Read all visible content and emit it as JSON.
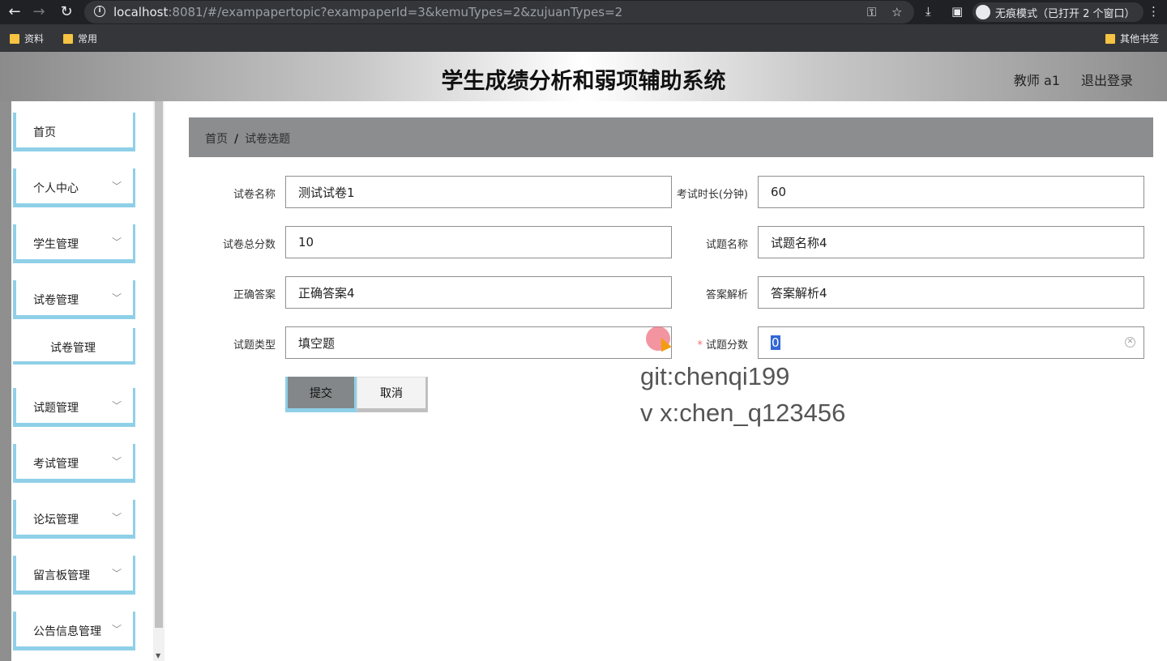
{
  "browser": {
    "url_host": "localhost",
    "url_rest": ":8081/#/exampapertopic?exampaperId=3&kemuTypes=2&zujuanTypes=2",
    "incognito_label": "无痕模式（已打开 2 个窗口）",
    "bookmarks": [
      "资料",
      "常用"
    ],
    "other_bookmarks": "其他书签"
  },
  "header": {
    "title": "学生成绩分析和弱项辅助系统",
    "user": "教师 a1",
    "logout": "退出登录"
  },
  "sidebar": {
    "items": [
      {
        "label": "首页"
      },
      {
        "label": "个人中心"
      },
      {
        "label": "学生管理"
      },
      {
        "label": "试卷管理"
      },
      {
        "label": "试卷管理"
      },
      {
        "label": "试题管理"
      },
      {
        "label": "考试管理"
      },
      {
        "label": "论坛管理"
      },
      {
        "label": "留言板管理"
      },
      {
        "label": "公告信息管理"
      }
    ]
  },
  "breadcrumb": {
    "home": "首页",
    "separator": "/",
    "current": "试卷选题"
  },
  "form": {
    "paper_name": {
      "label": "试卷名称",
      "value": "测试试卷1"
    },
    "duration": {
      "label": "考试时长(分钟)",
      "value": "60"
    },
    "total_score": {
      "label": "试卷总分数",
      "value": "10"
    },
    "question_name": {
      "label": "试题名称",
      "value": "试题名称4"
    },
    "answer": {
      "label": "正确答案",
      "value": "正确答案4"
    },
    "analysis": {
      "label": "答案解析",
      "value": "答案解析4"
    },
    "question_type": {
      "label": "试题类型",
      "value": "填空题"
    },
    "question_score": {
      "label": "试题分数",
      "required_mark": "*",
      "value": "0"
    },
    "submit": "提交",
    "cancel": "取消"
  },
  "overlay": {
    "line1": "git:chenqi199",
    "line2": "v x:chen_q123456"
  }
}
